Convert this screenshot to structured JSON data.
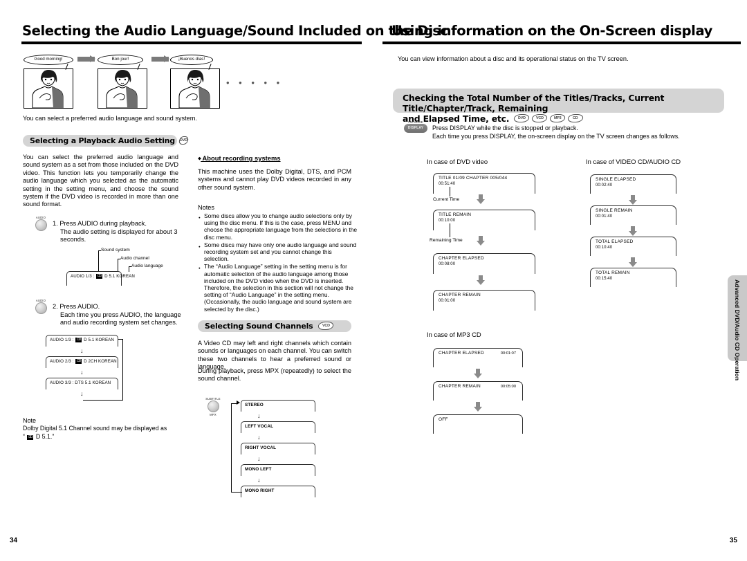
{
  "left_page": {
    "number": "34",
    "chapter_title": "Selecting the Audio Language/Sound Included on the Disc",
    "figure": {
      "bubbles": [
        "Good morning!",
        "Bon jour!",
        "¡Buenos días!"
      ],
      "trailing_dots": "• • • • •"
    },
    "lead_text": "You can select a preferred audio language and sound system.",
    "section1": {
      "title": "Selecting a Playback Audio Setting",
      "badges": [
        "DVD"
      ],
      "body": "You can select the preferred audio language and sound system as a set from those included on the DVD video. This function lets you temporarily change the audio language which you selected as the automatic setting in the setting menu, and choose the sound system if the DVD video is recorded in more than one sound format.",
      "step1": {
        "key_label": "AUDIO",
        "line1": "1. Press AUDIO during playback.",
        "line2": "The audio setting is displayed for about 3",
        "line3": "seconds."
      },
      "callouts": [
        "Sound system",
        "Audio channel",
        "Audio language"
      ],
      "display_example": {
        "prefix": "AUDIO 1/3 :",
        "dolby": "DD",
        "suffix": "D 5.1 KOREAN"
      },
      "step2": {
        "key_label": "AUDIO",
        "line1": "2. Press AUDIO.",
        "line2": "Each time you press AUDIO, the language",
        "line3": "and audio recording system set changes."
      },
      "cycle": [
        {
          "prefix": "AUDIO 1/3 :",
          "dolby": "DD",
          "suffix": "D 5.1 KOREAN"
        },
        {
          "prefix": "AUDIO 2/3 :",
          "dolby": "DD",
          "suffix": "D 2CH KOREAN"
        },
        {
          "prefix": "AUDIO 3/3 :",
          "dolby": "",
          "suffix": "DTS 5.1 KOREAN"
        }
      ],
      "note": {
        "title": "Note",
        "line1": "Dolby Digital 5.1 Channel sound may be displayed as",
        "line2_prefix": "“",
        "line2_dolby": "DD",
        "line2_suffix": "D 5.1.”"
      }
    },
    "section2": {
      "subhead": "About recording systems",
      "body": "This machine uses the Dolby Digital, DTS, and PCM systems and cannot play DVD videos recorded in any other sound system.",
      "notes_title": "Notes",
      "notes": [
        "Some discs allow you to change audio selections only by using the disc menu. If this is the case, press MENU and choose the appropriate language from the selections in the disc menu.",
        "Some discs may have only one audio language and sound recording system set and you cannot change this selection.",
        "The “Audio Language” setting in the setting menu is for automatic selection of the audio language among those included on the DVD video when the DVD is inserted. Therefore, the selection in this section will not change the setting of “Audio Language” in the setting menu. (Occasionally, the audio language and sound system are selected by the disc.)"
      ]
    },
    "section3": {
      "title": "Selecting Sound Channels",
      "badges": [
        "VCD"
      ],
      "body1": "A Video CD may left and right channels which contain sounds or languages on each channel. You can switch these two channels to hear a preferred sound or language.",
      "body2": "During playback, press MPX (repeatedly) to select the sound channel.",
      "key_label_top": "SUBTITLE",
      "key_label_bottom": "MPX",
      "channels": [
        "STEREO",
        "LEFT VOCAL",
        "RIGHT VOCAL",
        "MONO LEFT",
        "MONO RIGHT"
      ]
    }
  },
  "right_page": {
    "number": "35",
    "chapter_title": "Using information on the On-Screen display",
    "lead_text": "You can view information about a disc and its operational status on the TV screen.",
    "section": {
      "title_line1": "Checking the Total Number of the Titles/Tracks, Current Title/Chapter/Track, Remaining",
      "title_line2": "and Elapsed Time, etc.",
      "badges": [
        "DVD",
        "VCD",
        "MP3",
        "CD"
      ],
      "key_label_top": "FM MODE",
      "key_label_pill": "DISPLAY",
      "instruction_line1": "Press DISPLAY while the disc is stopped or playback.",
      "instruction_line2": "Each time you press DISPLAY, the on-screen display on the TV screen changes as follows."
    },
    "dvd_video": {
      "heading": "In case of DVD video",
      "callout1": "Current Time",
      "callout2": "Remaining Time",
      "boxes": [
        {
          "l1": "TITLE  01/09   CHAPTER  005/044",
          "l2": "00:51:40"
        },
        {
          "l1": "TITLE REMAIN",
          "l2": "00:10:00"
        },
        {
          "l1": "CHAPTER ELAPSED",
          "l2": "00:08:00"
        },
        {
          "l1": "CHAPTER REMAIN",
          "l2": "00:01:00"
        }
      ]
    },
    "video_audio_cd": {
      "heading": "In case of VIDEO CD/AUDIO CD",
      "boxes": [
        {
          "l1": "SINGLE ELAPSED",
          "l2": "00:02:40"
        },
        {
          "l1": "SINGLE REMAIN",
          "l2": "00:01:40"
        },
        {
          "l1": "TOTAL ELAPSED",
          "l2": "00:10:40"
        },
        {
          "l1": "TOTAL REMAIN",
          "l2": "00:15:40"
        }
      ]
    },
    "mp3_cd": {
      "heading": "In case of MP3 CD",
      "boxes": [
        {
          "l1": "CHAPTER ELAPSED",
          "r1": "00:01:07"
        },
        {
          "l1": "CHAPTER REMAIN",
          "r1": "00:05:00"
        },
        {
          "l1": "OFF",
          "r1": ""
        }
      ]
    },
    "side_tab": "Advanced DVD/Audio CD Operation"
  }
}
